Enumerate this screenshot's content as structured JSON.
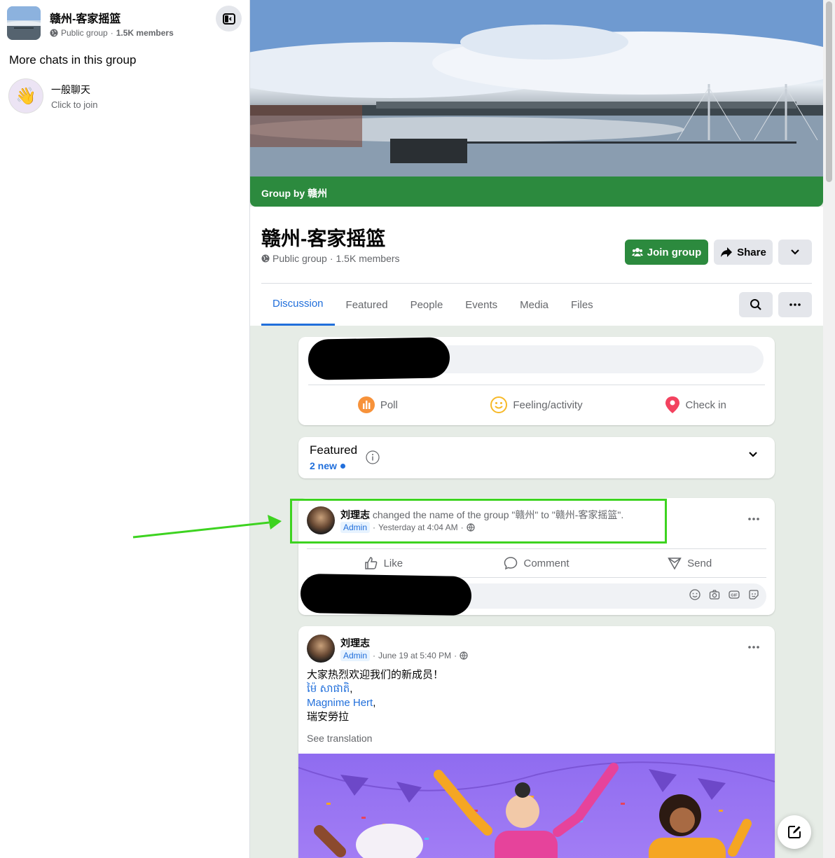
{
  "sidebar": {
    "group_title": "赣州-客家摇篮",
    "group_privacy": "Public group",
    "group_members": "1.5K members",
    "section_title": "More chats in this group",
    "chats": [
      {
        "name": "一般聊天",
        "subtitle": "Click to join",
        "emoji": "👋"
      }
    ]
  },
  "cover": {
    "band_text": "Group by 赣州"
  },
  "header": {
    "title": "赣州-客家摇篮",
    "privacy": "Public group",
    "members": "1.5K members",
    "join_label": "Join group",
    "share_label": "Share"
  },
  "tabs": [
    {
      "label": "Discussion",
      "active": true
    },
    {
      "label": "Featured"
    },
    {
      "label": "People"
    },
    {
      "label": "Events"
    },
    {
      "label": "Media"
    },
    {
      "label": "Files"
    }
  ],
  "composer": {
    "actions": [
      {
        "label": "Poll",
        "icon": "poll-icon",
        "color": "#f7923a"
      },
      {
        "label": "Feeling/activity",
        "icon": "feeling-icon",
        "color": "#f7b928"
      },
      {
        "label": "Check in",
        "icon": "location-pin-icon",
        "color": "#f3425f"
      }
    ]
  },
  "featured": {
    "title": "Featured",
    "new_count": "2 new"
  },
  "posts": [
    {
      "author": "刘理志",
      "action": " changed the name of the group \"赣州\" to \"赣州-客家摇篮\".",
      "badge": "Admin",
      "time": "Yesterday at 4:04 AM",
      "actions": {
        "like": "Like",
        "comment": "Comment",
        "send": "Send"
      }
    },
    {
      "author": "刘理志",
      "badge": "Admin",
      "time": "June 19 at 5:40 PM",
      "lines": [
        "大家热烈欢迎我们的新成员！",
        "ម៉ៃ សាផាតិ",
        "Magnime Hert",
        "瑞安勞拉"
      ],
      "see_translation": "See translation"
    }
  ],
  "colors": {
    "accent_green": "#2c8a3e",
    "link_blue": "#216fdb",
    "highlight": "#3dd320"
  }
}
